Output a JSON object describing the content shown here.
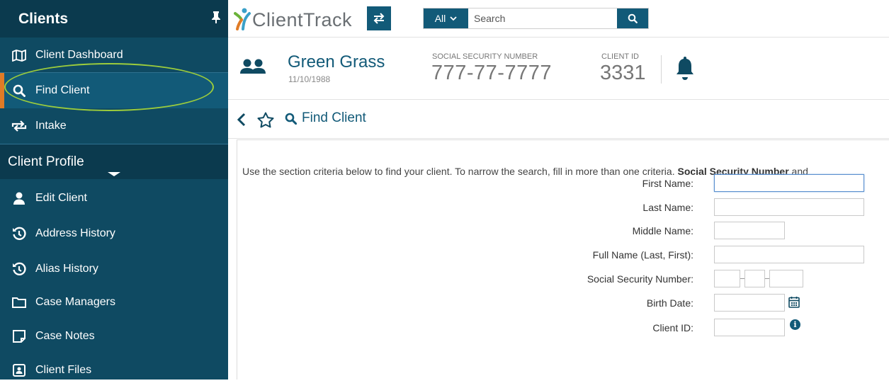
{
  "sidebar": {
    "title": "Clients",
    "pin_icon": "pin-icon",
    "items": [
      {
        "label": "Client Dashboard",
        "icon": "map-icon"
      },
      {
        "label": "Find Client",
        "icon": "search-icon",
        "active": true
      },
      {
        "label": "Intake",
        "icon": "repeat-icon"
      }
    ],
    "section_title": "Client Profile",
    "profile_items": [
      {
        "label": "Edit Client",
        "icon": "user-icon"
      },
      {
        "label": "Address History",
        "icon": "history-icon"
      },
      {
        "label": "Alias History",
        "icon": "history-icon"
      },
      {
        "label": "Case Managers",
        "icon": "folder-icon"
      },
      {
        "label": "Case Notes",
        "icon": "note-icon"
      },
      {
        "label": "Client Files",
        "icon": "contact-card-icon"
      }
    ]
  },
  "topbar": {
    "logo_text": "ClientTrack",
    "search_scope": "All",
    "search_placeholder": "Search"
  },
  "client": {
    "name": "Green Grass",
    "dob": "11/10/1988",
    "ssn_label": "SOCIAL SECURITY NUMBER",
    "ssn_value": "777-77-7777",
    "client_id_label": "CLIENT ID",
    "client_id_value": "3331"
  },
  "page": {
    "title": "Find Client"
  },
  "form": {
    "instructions_pre": "Use the section criteria below to find your client. To narrow the search, fill in more than one criteria. ",
    "instructions_bold": "Social Security Number",
    "instructions_post": " and",
    "first_name_label": "First Name:",
    "last_name_label": "Last Name:",
    "middle_name_label": "Middle Name:",
    "full_name_label": "Full Name (Last, First):",
    "ssn_label": "Social Security Number:",
    "birth_date_label": "Birth Date:",
    "client_id_label": "Client ID:"
  },
  "colors": {
    "sidebar_bg": "#0f4a62",
    "sidebar_header_bg": "#0b3a4e",
    "active_item_bg": "#125a78",
    "active_accent": "#e07b26",
    "brand_blue": "#125a78",
    "highlight_ellipse": "#9ccc3c"
  }
}
